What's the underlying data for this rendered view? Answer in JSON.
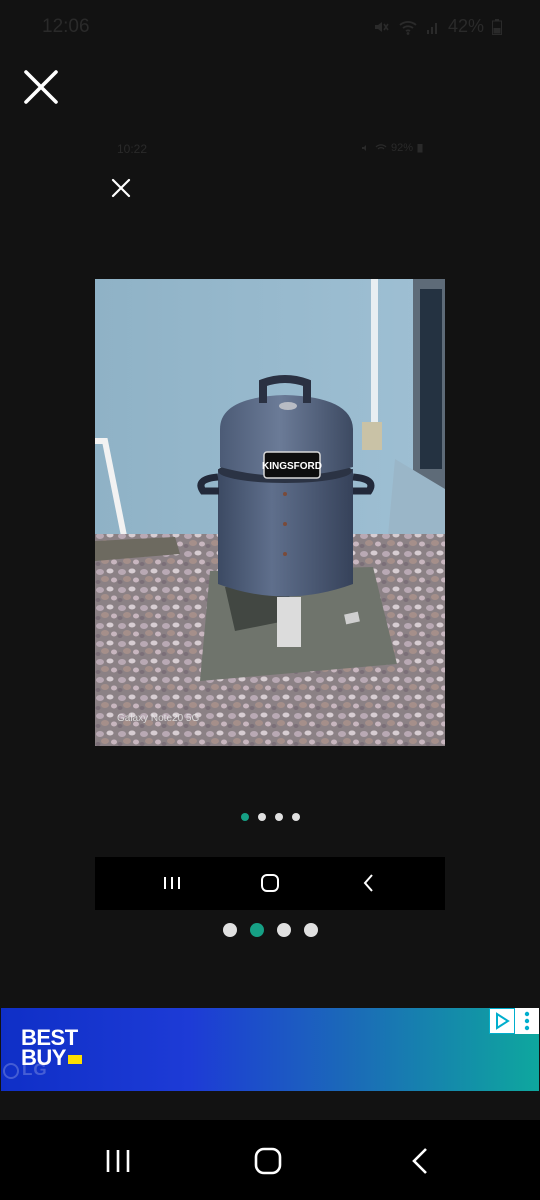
{
  "status_bar": {
    "time": "12:06",
    "battery": "42%",
    "icons": [
      "mute-icon",
      "wifi-icon",
      "signal-icon",
      "battery-icon"
    ]
  },
  "viewer": {
    "close_icon": "close-icon"
  },
  "inner_screenshot": {
    "time": "10:22",
    "battery": "92%",
    "close_icon": "close-icon",
    "photo": {
      "brand_label": "KINGSFORD",
      "watermark": "Galaxy Note20 5G"
    },
    "dots": {
      "count": 4,
      "active_index": 0
    },
    "nav": [
      "recents-icon",
      "home-icon",
      "back-icon"
    ]
  },
  "pager": {
    "count": 4,
    "active_index": 1
  },
  "ad": {
    "logo_line1": "BEST",
    "logo_line2": "BUY",
    "partner": "LG",
    "colors": {
      "start": "#0f2fc7",
      "end": "#0ea79e",
      "tag": "#ffe000"
    }
  },
  "system_nav": [
    "recents-icon",
    "home-icon",
    "back-icon"
  ],
  "colors": {
    "background": "#121212",
    "accent": "#16a085"
  }
}
